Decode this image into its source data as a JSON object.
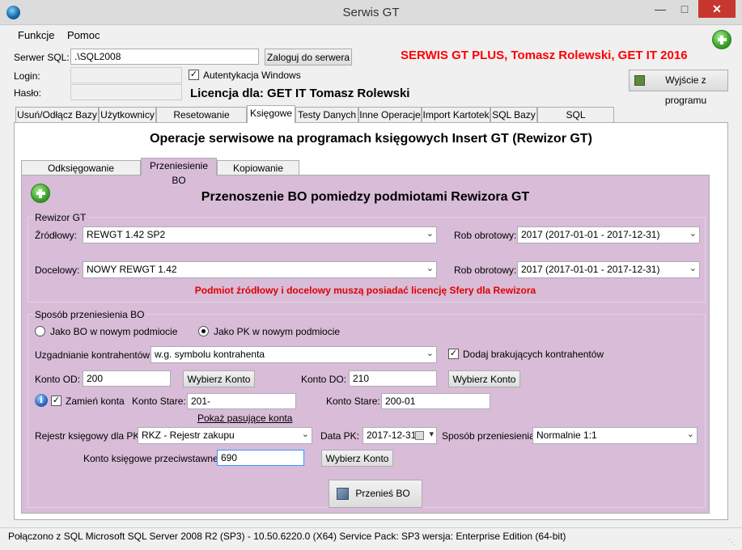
{
  "window": {
    "title": "Serwis GT"
  },
  "menu": {
    "items": [
      "Funkcje",
      "Pomoc"
    ]
  },
  "server": {
    "sql_label": "Serwer SQL:",
    "sql_value": ".\\SQL2008",
    "login_button": "Zaloguj do serwera",
    "login_label": "Login:",
    "password_label": "Hasło:",
    "windows_auth_label": "Autentykacja Windows",
    "windows_auth_checked": true,
    "banner": "SERWIS GT PLUS, Tomasz Rolewski, GET IT 2016",
    "license": "Licencja dla: GET IT Tomasz Rolewski",
    "exit_button": "Wyjście z programu"
  },
  "tabs": [
    "Usuń/Odłącz Bazy",
    "Użytkownicy",
    "Resetowanie Licencji",
    "Księgowe",
    "Testy Danych",
    "Inne Operacje",
    "Import Kartotek",
    "SQL Bazy",
    "SQL Użytkownicy"
  ],
  "active_tab": "Księgowe",
  "panel": {
    "heading": "Operacje serwisowe na programach księgowych  Insert GT (Rewizor GT)"
  },
  "subtabs": [
    "Odksięgowanie dokumentów",
    "Przeniesienie BO",
    "Kopiowanie danych"
  ],
  "active_subtab": "Przeniesienie BO",
  "bo": {
    "heading": "Przenoszenie BO pomiedzy podmiotami Rewizora GT",
    "rewizor_group": "Rewizor GT",
    "source_label": "Źródłowy:",
    "source_value": "REWGT 1.42 SP2",
    "year_label": "Rob obrotowy:",
    "source_year": "2017 (2017-01-01 - 2017-12-31)",
    "target_label": "Docelowy:",
    "target_value": "NOWY REWGT 1.42",
    "target_year": "2017 (2017-01-01 - 2017-12-31)",
    "warning": "Podmiot źródłowy i docelowy muszą posiadać licencję Sfery dla Rewizora",
    "method_group": "Sposób przeniesienia BO",
    "radio_bo": "Jako BO w nowym podmiocie",
    "radio_pk": "Jako PK w nowym podmiocie",
    "selected_radio": "Jako PK w nowym podmiocie",
    "match_label": "Uzgadnianie kontrahentów:",
    "match_value": "w.g. symbolu kontrahenta",
    "add_missing_label": "Dodaj brakujących kontrahentów",
    "add_missing_checked": true,
    "from_label": "Konto OD:",
    "from_value": "200",
    "choose_account": "Wybierz Konto",
    "to_label": "Konto DO:",
    "to_value": "210",
    "swap_label": "Zamień konta",
    "swap_checked": true,
    "old_account_label": "Konto Stare:",
    "old_account_1": "201-",
    "old_account_2": "200-01",
    "show_matching_link": "Pokaż pasujące konta",
    "register_label": "Rejestr księgowy dla PK:",
    "register_value": "RKZ - Rejestr zakupu",
    "date_label": "Data PK:",
    "date_value": "2017-12-31",
    "method_label": "Sposób przeniesienia:",
    "method_value": "Normalnie 1:1",
    "counter_label": "Konto księgowe przeciwstawne:",
    "counter_value": "690",
    "transfer_button": "Przenieś BO"
  },
  "status": {
    "text": "Połączono z SQL  Microsoft SQL Server 2008 R2 (SP3) - 10.50.6220.0 (X64)   Service Pack: SP3  wersja: Enterprise Edition (64-bit)"
  },
  "colors": {
    "banner": "#ff0000",
    "warning": "#dd0000",
    "panel_bg": "#d8bcd8",
    "close_button": "#c7372f"
  }
}
